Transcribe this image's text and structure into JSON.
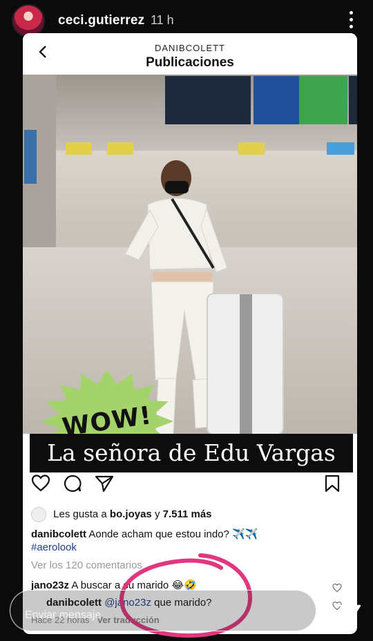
{
  "story": {
    "username": "ceci.gutierrez",
    "time": "11 h",
    "menu_icon": "more-vertical-icon"
  },
  "post_header": {
    "account": "DANIBCOLETT",
    "title": "Publicaciones",
    "back_icon": "chevron-left-icon"
  },
  "image_overlays": {
    "badge_text": "WOW!",
    "badge_color": "#a5d36b",
    "banner_text": "La señora de Edu Vargas"
  },
  "actions": {
    "like_icon": "heart-icon",
    "comment_icon": "comment-icon",
    "share_icon": "send-icon",
    "save_icon": "bookmark-icon"
  },
  "likes": {
    "prefix": "Les gusta a",
    "user": "bo.joyas",
    "conj": "y",
    "count": "7.511 más"
  },
  "caption": {
    "user": "danibcolett",
    "text": "Aonde acham que estou indo? ✈️✈️",
    "hashtag": "#aerolook"
  },
  "comments": {
    "view_all": "Ver los 120 comentarios",
    "items": [
      {
        "user": "jano23z",
        "text": "A buscar a su marido 😂🤣"
      }
    ],
    "reply": {
      "user": "danibcolett",
      "mention": "@jano23z",
      "text": "que marido?"
    },
    "reply_meta": {
      "time": "Hace 22 horas",
      "translate": "Ver traducción"
    }
  },
  "annotation": {
    "color": "#e0377e"
  },
  "composer": {
    "placeholder": "Enviar mensaje",
    "send_icon": "paper-plane-icon"
  }
}
